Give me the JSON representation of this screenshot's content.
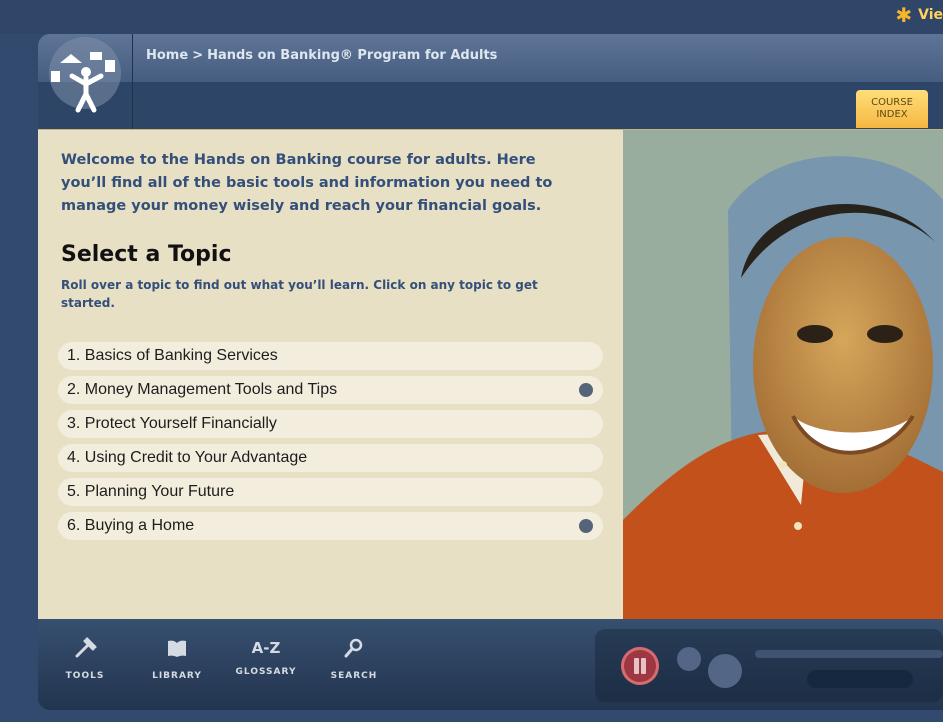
{
  "top_link": {
    "icon": "asterisk-icon",
    "label": "Vie"
  },
  "header": {
    "logo": "hands-on-banking-logo",
    "breadcrumb": {
      "home": "Home",
      "separator": ">",
      "current": "Hands on Banking® Program for Adults"
    },
    "course_index": {
      "line1": "COURSE",
      "line2": "INDEX"
    }
  },
  "main": {
    "intro": "Welcome to the Hands on Banking course for adults. Here you’ll find all of the basic tools and information you need to manage your money wisely and reach your financial goals.",
    "title": "Select a Topic",
    "subtitle": "Roll over a topic to find out what you’ll learn. Click on any topic to get started.",
    "topics": [
      {
        "label": "1. Basics of Banking Services",
        "marker": false
      },
      {
        "label": "2. Money Management Tools and Tips",
        "marker": true
      },
      {
        "label": "3. Protect Yourself Financially",
        "marker": false
      },
      {
        "label": "4. Using Credit to Your Advantage",
        "marker": false
      },
      {
        "label": "5. Planning Your Future",
        "marker": false
      },
      {
        "label": "6. Buying a Home",
        "marker": true
      }
    ]
  },
  "footer": {
    "tools": [
      {
        "label": "TOOLS",
        "icon": "hammer-icon"
      },
      {
        "label": "LIBRARY",
        "icon": "book-icon"
      },
      {
        "label": "GLOSSARY",
        "icon_text": "A-Z"
      },
      {
        "label": "SEARCH",
        "icon": "search-icon"
      }
    ],
    "player": {
      "state": "paused"
    }
  },
  "colors": {
    "accent_yellow": "#f5b743",
    "header_blue": "#455d80",
    "content_bg": "#e8e0c5",
    "heading_blue": "#334f7a"
  }
}
